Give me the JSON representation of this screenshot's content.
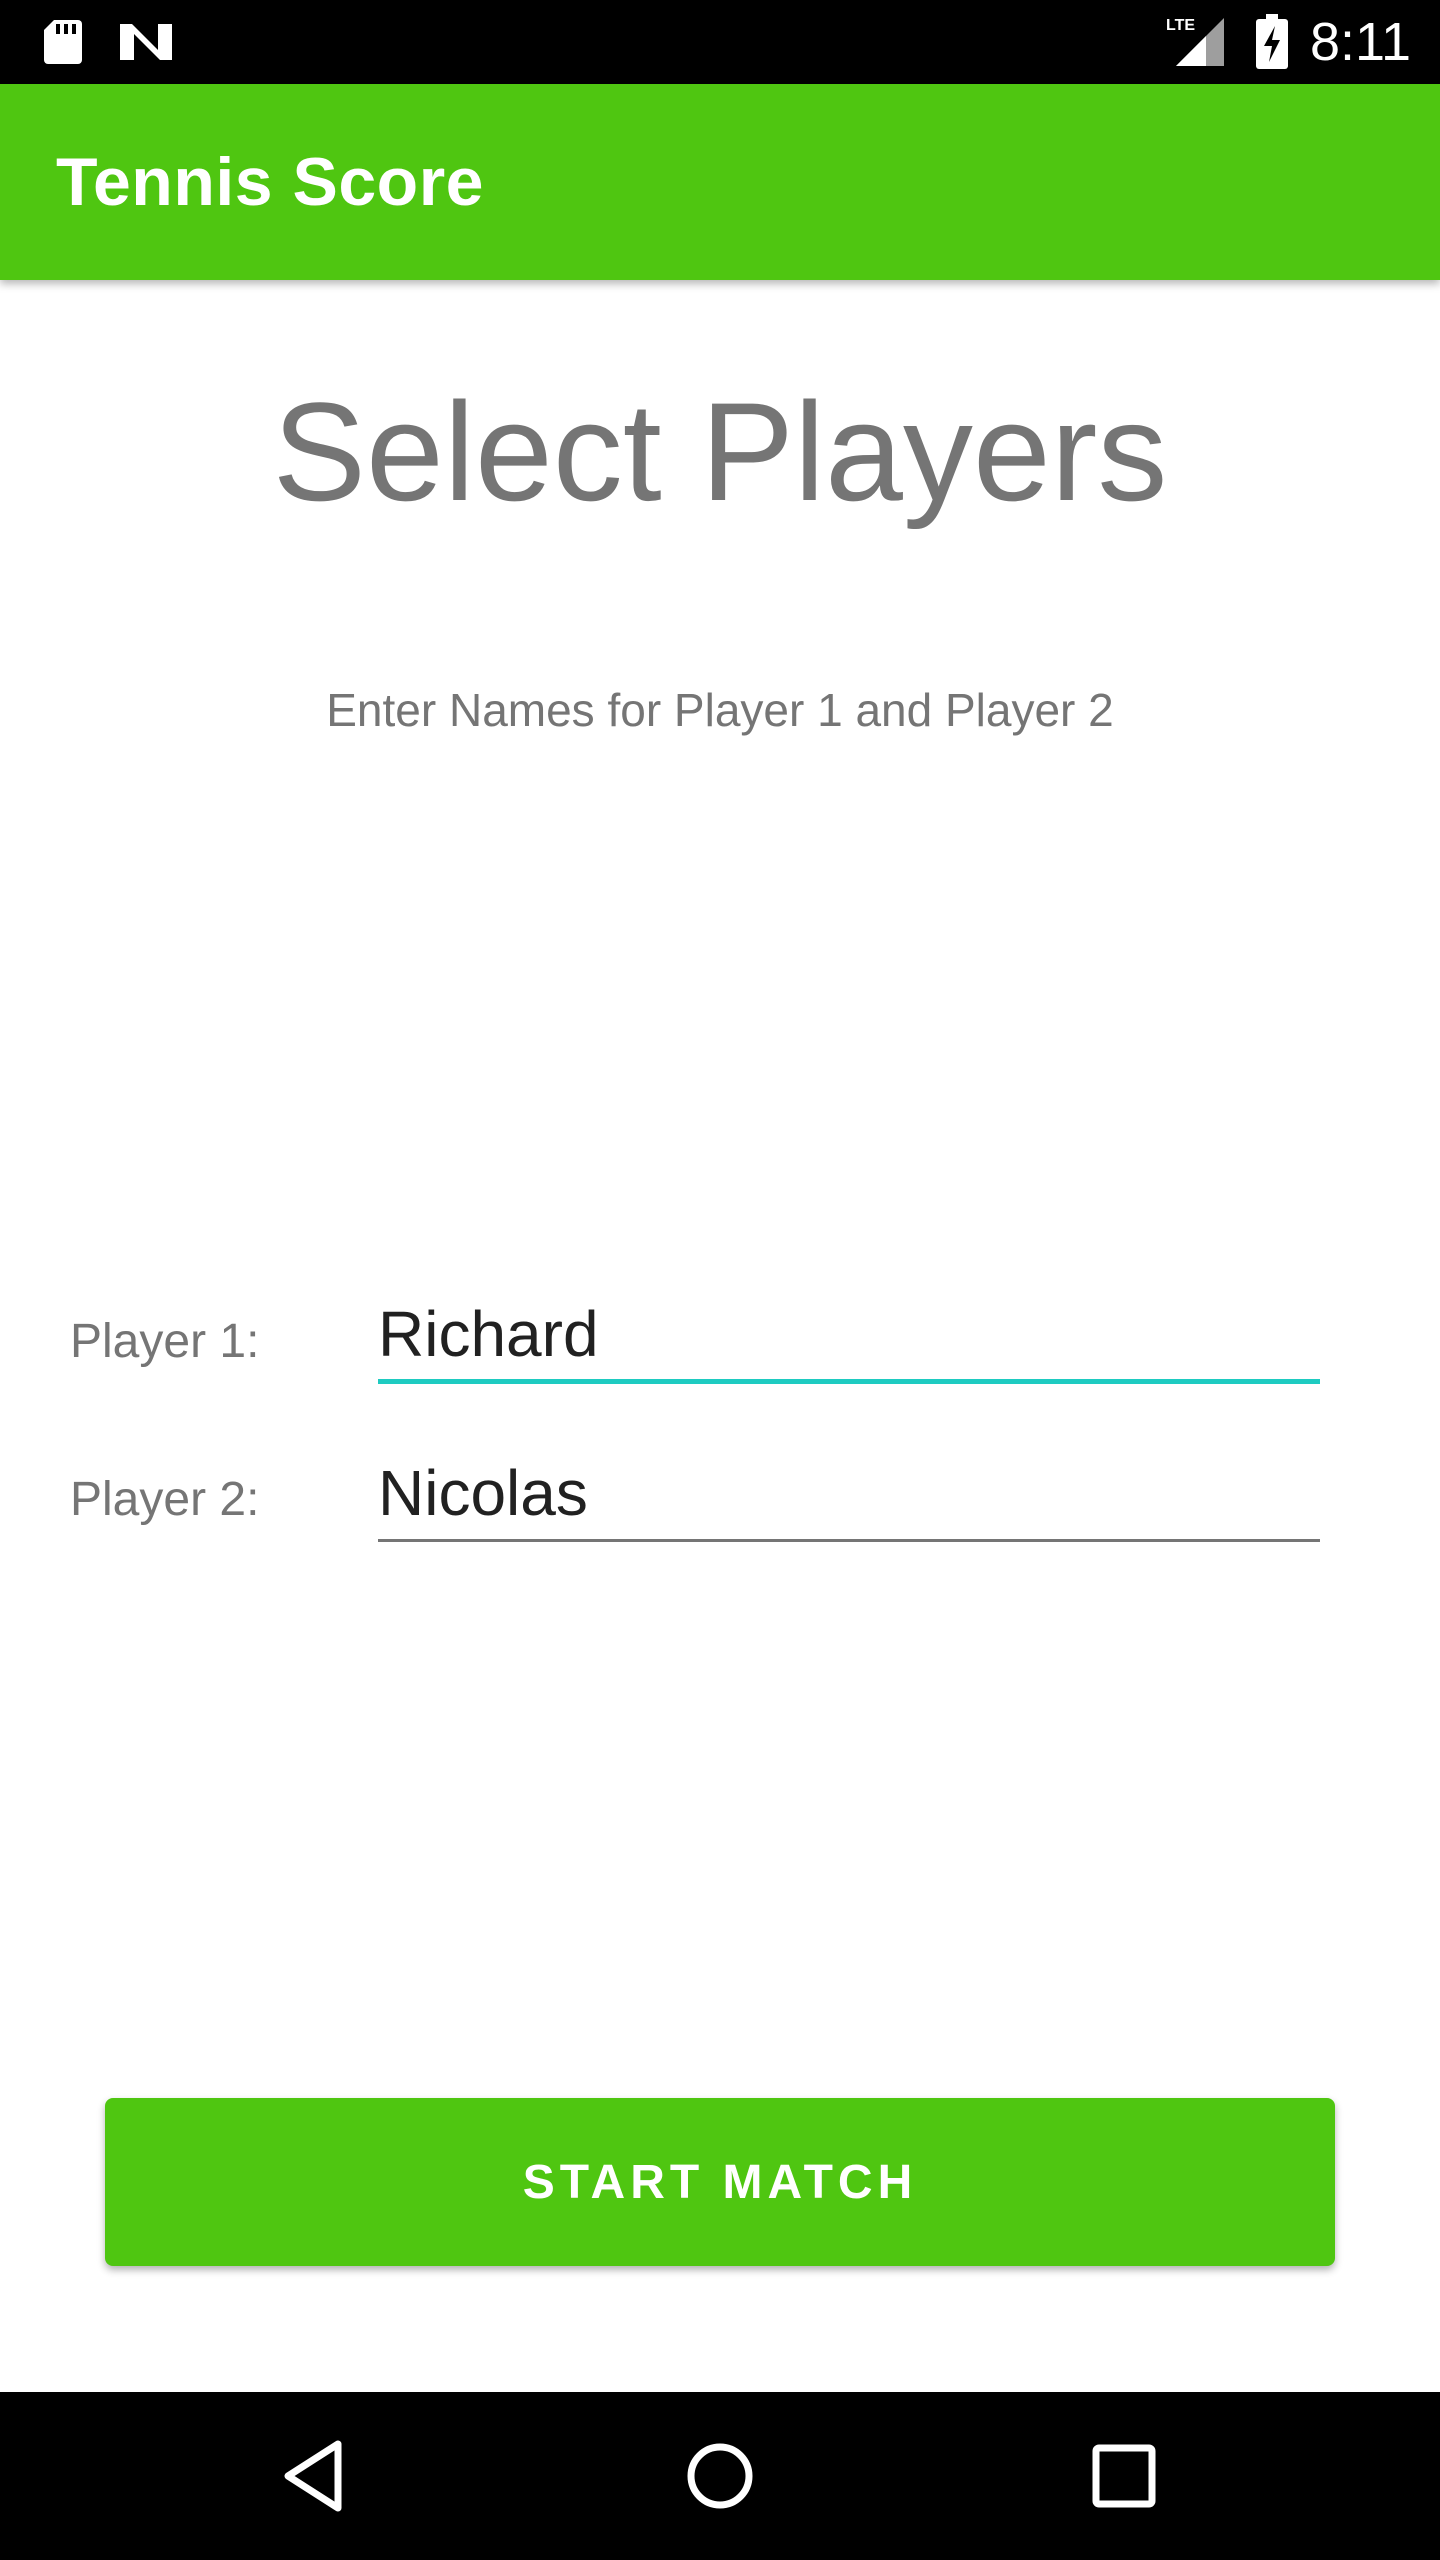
{
  "status_bar": {
    "time": "8:11",
    "network_label": "LTE",
    "icons": [
      "sd-card-icon",
      "n-logo-icon",
      "lte-signal-icon",
      "battery-charging-icon"
    ]
  },
  "app_bar": {
    "title": "Tennis Score",
    "color": "#4fc611"
  },
  "main": {
    "title": "Select Players",
    "subtitle": "Enter Names for Player 1 and Player 2",
    "players": [
      {
        "label": "Player 1:",
        "value": "Richard"
      },
      {
        "label": "Player 2:",
        "value": "Nicolas"
      }
    ],
    "start_button_label": "START MATCH",
    "focus_color": "#1ecbc1"
  },
  "nav_bar": {
    "icons": [
      "back-icon",
      "home-icon",
      "recents-icon"
    ]
  }
}
